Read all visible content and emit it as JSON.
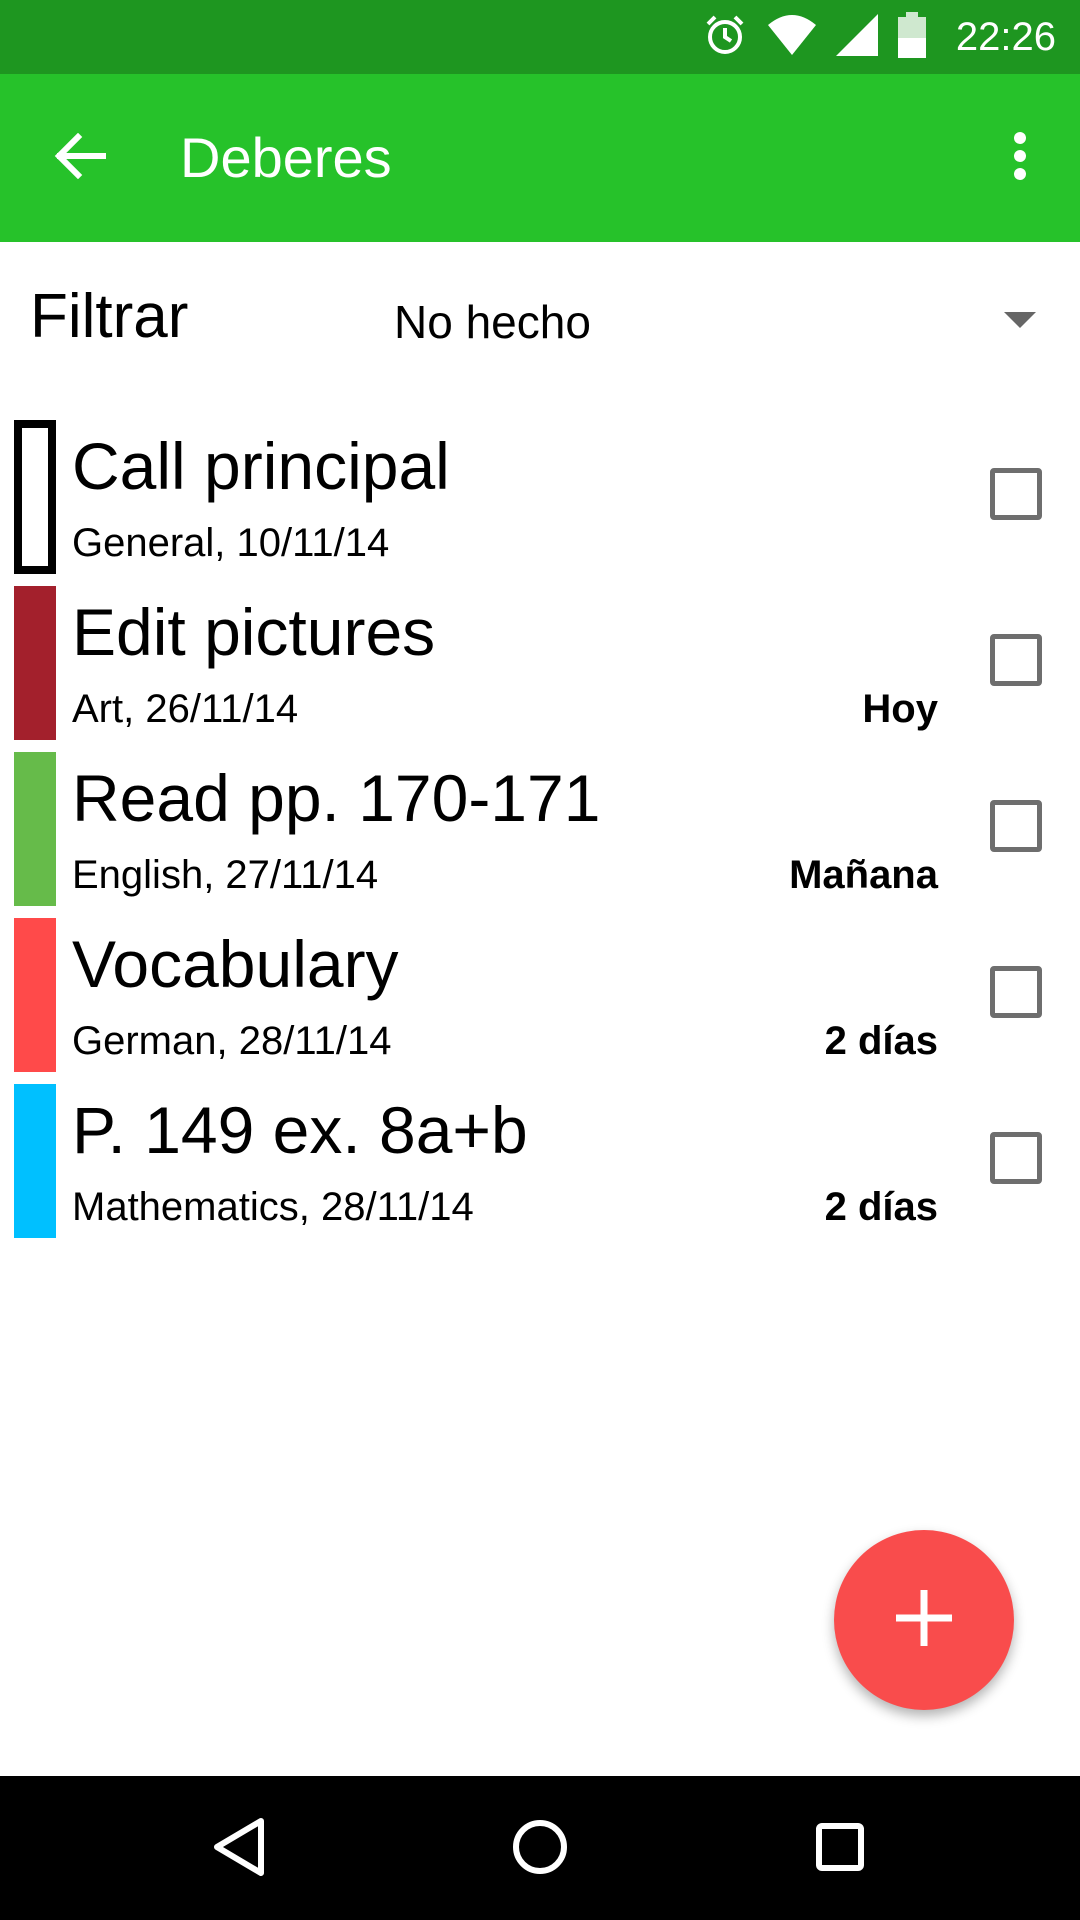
{
  "status_bar": {
    "time": "22:26",
    "icons": [
      "alarm-icon",
      "wifi-icon",
      "signal-icon",
      "battery-icon"
    ]
  },
  "app_bar": {
    "title": "Deberes",
    "back_icon": "arrow-back-icon",
    "menu_icon": "more-vert-icon",
    "background_color": "#26c22a"
  },
  "filter": {
    "label": "Filtrar",
    "selected": "No hecho"
  },
  "tasks": [
    {
      "title": "Call principal",
      "subtitle": "General, 10/11/14",
      "due": "",
      "color": "#000000",
      "outlined": true,
      "done": false
    },
    {
      "title": "Edit pictures",
      "subtitle": "Art, 26/11/14",
      "due": "Hoy",
      "color": "#a3202c",
      "outlined": false,
      "done": false
    },
    {
      "title": "Read pp. 170-171",
      "subtitle": "English, 27/11/14",
      "due": "Mañana",
      "color": "#66bb4a",
      "outlined": false,
      "done": false
    },
    {
      "title": "Vocabulary",
      "subtitle": "German, 28/11/14",
      "due": "2 días",
      "color": "#ff4a4a",
      "outlined": false,
      "done": false
    },
    {
      "title": "P. 149 ex. 8a+b",
      "subtitle": "Mathematics, 28/11/14",
      "due": "2 días",
      "color": "#00c0ff",
      "outlined": false,
      "done": false
    }
  ],
  "fab": {
    "icon": "plus-icon",
    "color": "#f94c4c"
  },
  "nav_bar": {
    "icons": [
      "back-triangle-icon",
      "home-circle-icon",
      "recents-square-icon"
    ]
  }
}
